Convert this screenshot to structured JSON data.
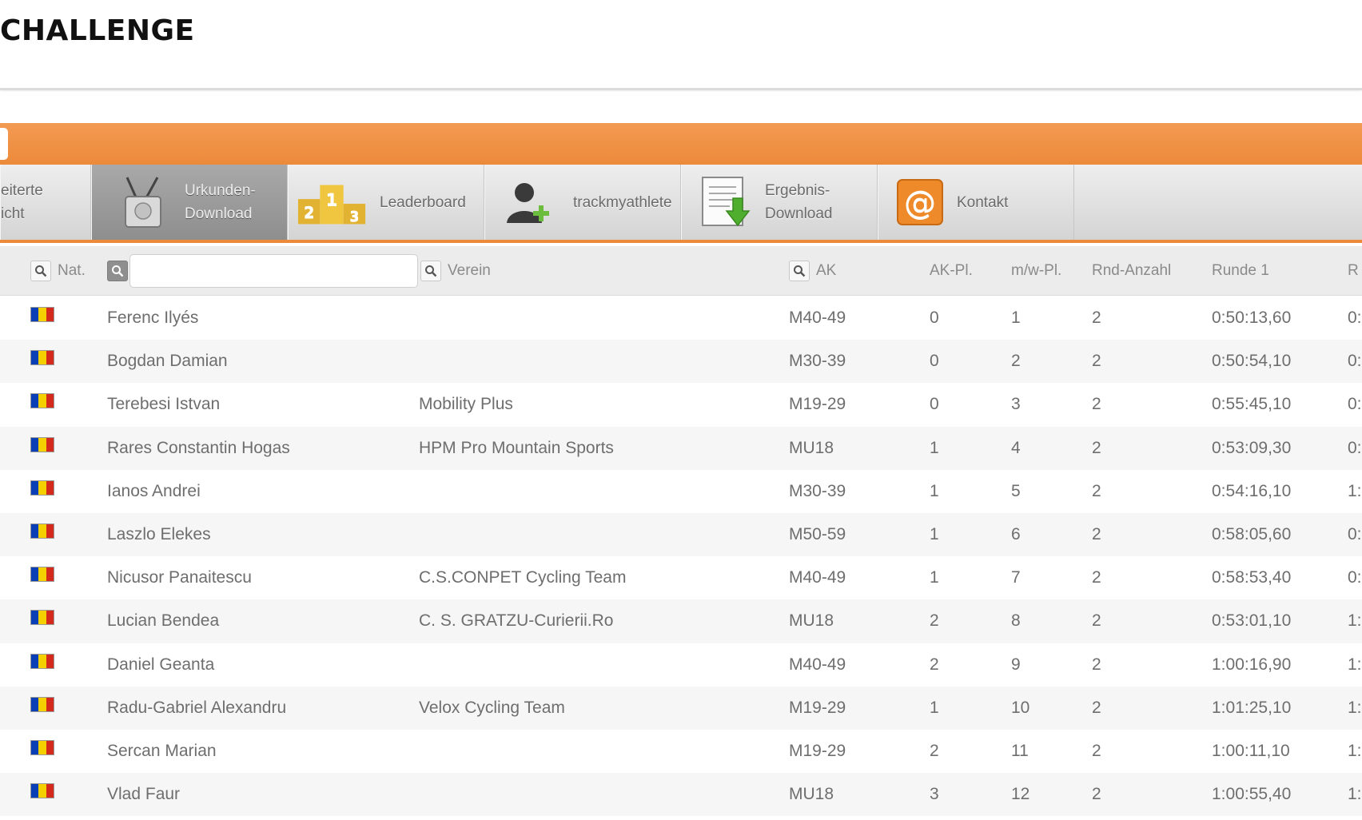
{
  "page": {
    "title": "CHALLENGE"
  },
  "nav": {
    "items": [
      {
        "key": "erweiterte",
        "label": "eiterte\nicht",
        "icon": "partial-icon"
      },
      {
        "key": "urkunden",
        "label": "Urkunden-\nDownload",
        "icon": "certificate-medal-icon"
      },
      {
        "key": "leaderboard",
        "label": "Leaderboard",
        "icon": "podium-icon",
        "podium": [
          "2",
          "1",
          "3"
        ]
      },
      {
        "key": "trackmyathlete",
        "label": "trackmyathlete",
        "icon": "user-add-icon"
      },
      {
        "key": "ergebnis",
        "label": "Ergebnis-\nDownload",
        "icon": "document-download-icon"
      },
      {
        "key": "kontakt",
        "label": "Kontakt",
        "icon": "at-sign-icon"
      }
    ]
  },
  "table": {
    "headers": {
      "nat": "Nat.",
      "verein": "Verein",
      "ak": "AK",
      "akpl": "AK-Pl.",
      "mw": "m/w-Pl.",
      "rnd": "Rnd-Anzahl",
      "r1": "Runde 1",
      "r2": "R"
    },
    "search": {
      "value": "",
      "placeholder": ""
    },
    "flag_colors": [
      "#0b3fb5",
      "#f5d000",
      "#d42a1d"
    ],
    "rows": [
      {
        "name": "Ferenc Ilyés",
        "club": "",
        "ak": "M40-49",
        "akpl": "0",
        "mw": "1",
        "rnd": "2",
        "r1": "0:50:13,60",
        "r2": "0:"
      },
      {
        "name": "Bogdan Damian",
        "club": "",
        "ak": "M30-39",
        "akpl": "0",
        "mw": "2",
        "rnd": "2",
        "r1": "0:50:54,10",
        "r2": "0:"
      },
      {
        "name": "Terebesi Istvan",
        "club": "Mobility Plus",
        "ak": "M19-29",
        "akpl": "0",
        "mw": "3",
        "rnd": "2",
        "r1": "0:55:45,10",
        "r2": "0:"
      },
      {
        "name": "Rares Constantin Hogas",
        "club": "HPM Pro Mountain Sports",
        "ak": "MU18",
        "akpl": "1",
        "mw": "4",
        "rnd": "2",
        "r1": "0:53:09,30",
        "r2": "0:"
      },
      {
        "name": "Ianos Andrei",
        "club": "",
        "ak": "M30-39",
        "akpl": "1",
        "mw": "5",
        "rnd": "2",
        "r1": "0:54:16,10",
        "r2": "1:"
      },
      {
        "name": "Laszlo Elekes",
        "club": "",
        "ak": "M50-59",
        "akpl": "1",
        "mw": "6",
        "rnd": "2",
        "r1": "0:58:05,60",
        "r2": "0:"
      },
      {
        "name": "Nicusor Panaitescu",
        "club": "C.S.CONPET Cycling Team",
        "ak": "M40-49",
        "akpl": "1",
        "mw": "7",
        "rnd": "2",
        "r1": "0:58:53,40",
        "r2": "0:"
      },
      {
        "name": "Lucian Bendea",
        "club": "C. S. GRATZU-Curierii.Ro",
        "ak": "MU18",
        "akpl": "2",
        "mw": "8",
        "rnd": "2",
        "r1": "0:53:01,10",
        "r2": "1:"
      },
      {
        "name": "Daniel Geanta",
        "club": "",
        "ak": "M40-49",
        "akpl": "2",
        "mw": "9",
        "rnd": "2",
        "r1": "1:00:16,90",
        "r2": "1:"
      },
      {
        "name": "Radu-Gabriel Alexandru",
        "club": "Velox Cycling Team",
        "ak": "M19-29",
        "akpl": "1",
        "mw": "10",
        "rnd": "2",
        "r1": "1:01:25,10",
        "r2": "1:"
      },
      {
        "name": "Sercan Marian",
        "club": "",
        "ak": "M19-29",
        "akpl": "2",
        "mw": "11",
        "rnd": "2",
        "r1": "1:00:11,10",
        "r2": "1:"
      },
      {
        "name": "Vlad Faur",
        "club": "",
        "ak": "MU18",
        "akpl": "3",
        "mw": "12",
        "rnd": "2",
        "r1": "1:00:55,40",
        "r2": "1:"
      }
    ]
  }
}
